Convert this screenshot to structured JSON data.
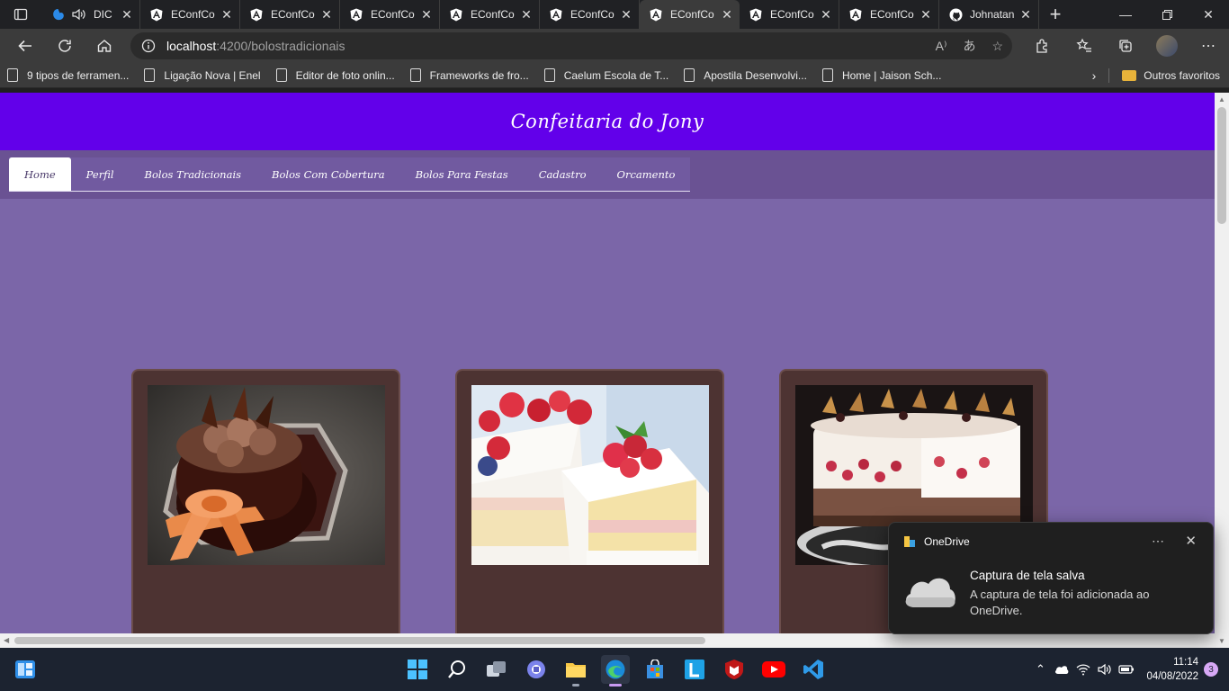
{
  "browser": {
    "tabs": [
      {
        "title": "DIC",
        "kind": "edge",
        "audio": true
      },
      {
        "title": "EConfCo",
        "kind": "angular"
      },
      {
        "title": "EConfCo",
        "kind": "angular"
      },
      {
        "title": "EConfCo",
        "kind": "angular"
      },
      {
        "title": "EConfCo",
        "kind": "angular"
      },
      {
        "title": "EConfCo",
        "kind": "angular"
      },
      {
        "title": "EConfCo",
        "kind": "angular",
        "active": true
      },
      {
        "title": "EConfCo",
        "kind": "angular"
      },
      {
        "title": "EConfCo",
        "kind": "angular"
      },
      {
        "title": "Johnatan",
        "kind": "github"
      }
    ],
    "address": {
      "host": "localhost",
      "path": ":4200/bolostradicionais"
    },
    "bookmarks": [
      "9 tipos de ferramen...",
      "Ligação Nova | Enel",
      "Editor de foto onlin...",
      "Frameworks de fro...",
      "Caelum Escola de T...",
      "Apostila Desenvolvi...",
      "Home | Jaison Sch..."
    ],
    "other_favorites": "Outros favoritos"
  },
  "site": {
    "title": "Confeitaria do Jony",
    "nav": [
      "Home",
      "Perfil",
      "Bolos Tradicionais",
      "Bolos Com Cobertura",
      "Bolos Para Festas",
      "Cadastro",
      "Orcamento"
    ],
    "active_nav": "Home",
    "colors": {
      "header": "#6200ea",
      "background": "#7b66a8",
      "card": "#4d3332"
    }
  },
  "toast": {
    "app": "OneDrive",
    "title": "Captura de tela salva",
    "body": "A captura de tela foi adicionada ao OneDrive."
  },
  "taskbar": {
    "time": "11:14",
    "date": "04/08/2022",
    "notifications": "3"
  }
}
